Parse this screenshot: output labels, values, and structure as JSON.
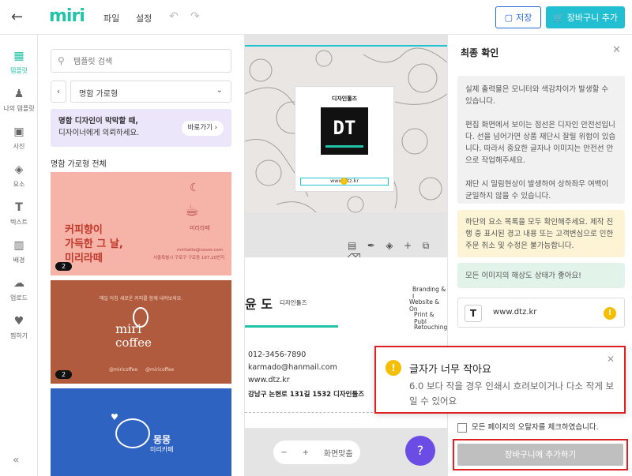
{
  "topbar": {
    "logo": "miri",
    "menu": [
      "파일",
      "설정"
    ],
    "save_label": "저장",
    "cart_label": "장바구니 추가"
  },
  "leftnav": [
    {
      "label": "템플릿",
      "icon": "template-icon",
      "active": true
    },
    {
      "label": "나의 템플릿",
      "icon": "my-template-icon"
    },
    {
      "label": "사진",
      "icon": "photo-icon"
    },
    {
      "label": "요소",
      "icon": "elements-icon"
    },
    {
      "label": "텍스트",
      "icon": "text-icon"
    },
    {
      "label": "배경",
      "icon": "background-icon"
    },
    {
      "label": "업로드",
      "icon": "upload-icon"
    },
    {
      "label": "찜하기",
      "icon": "heart-icon"
    }
  ],
  "templates": {
    "search_placeholder": "템플릿 검색",
    "select_value": "명함 가로형",
    "promo_text_1": "명함 디자인이 막막할 때,",
    "promo_text_2": "디자이너에게 의뢰하세요.",
    "promo_button": "바로가기",
    "section_title": "명함 가로형 전체",
    "card1": {
      "headline1": "커피향이",
      "headline2": "가득한 그 날,",
      "headline3": "미리라떼",
      "brand": "미리라떼",
      "email": "miritatte@naver.com",
      "addr": "서울특별시 구로구 구로동 197.20번지",
      "badge": "2"
    },
    "card2": {
      "tag": "매일 아침 새로운 커피를 함께 내려보세요.",
      "brand1": "miri",
      "brand2": "coffee",
      "social1": "@miricoffee",
      "social2": "@miricoffee",
      "badge": "2"
    },
    "card3": {
      "brand1": "몽몽",
      "brand2": "미리카페"
    }
  },
  "canvas": {
    "logo_title": "디자인툴즈",
    "logo_mark": "DT",
    "url_text": "www.dtz.kr",
    "name": "윤 도",
    "company": "디자인툴즈",
    "services": [
      "Branding & I",
      "Website & On",
      "Print & Publ",
      "Retouching"
    ],
    "phone": "012-3456-7890",
    "email": "karmado@hanmail.com",
    "website": "www.dtz.kr",
    "address": "강남구 논현로 131길 1532 디자인툴즈",
    "zoom_label": "화면맞춤"
  },
  "final_check": {
    "title": "최종 확인",
    "notice1": "실제 출력물은 모니터와 색감차이가 발생할 수 있습니다.\n\n편집 화면에서 보이는 점선은 디자인 안전선입니다. 선을 넘어가면 상품 재단시 잘릴 위험이 있습니다. 따라서 중요한 글자나 이미지는 안전선 안으로 작업해주세요.\n\n재단 시 밀림현상이 발생하여 상하좌우 여백이 균일하지 않을 수 있습니다.",
    "notice2": "하단의 요소 목록을 모두 확인해주세요. 제작 진행 중 표시된 경고 내용 또는 고객변심으로 인한 주문 취소 및 수정은 불가능합니다.",
    "notice3": "모든 이미지의 해상도 상태가 좋아요!",
    "item_url": "www.dtz.kr",
    "item_icon": "T",
    "confirm_label": "모든 페이지의 오탈자를 체크하였습니다.",
    "add_cart_label": "장바구니에 추가하기"
  },
  "toast": {
    "title": "글자가 너무 작아요",
    "message": "6.0 보다 작을 경우 인쇄시 흐려보이거나 다소 작게 보일 수 있어요"
  },
  "colors": {
    "brand": "#22c3a6",
    "accent": "#22bfd2",
    "primary": "#2b6cd4",
    "warning": "#f5bf00",
    "highlight": "#e02020"
  }
}
